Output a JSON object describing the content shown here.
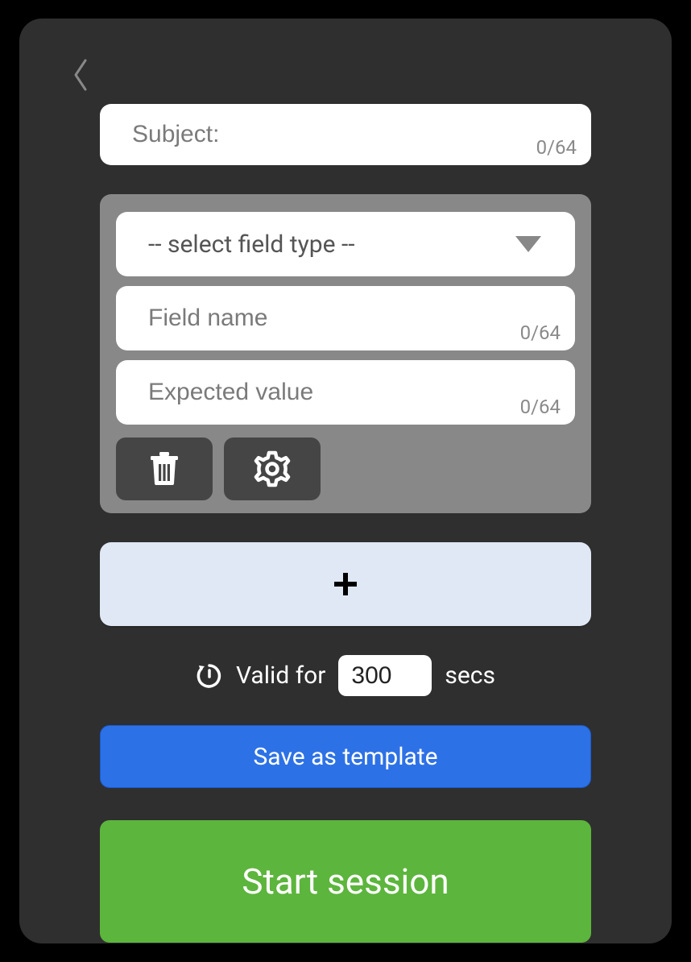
{
  "subject": {
    "placeholder": "Subject:",
    "value": "",
    "counter": "0/64"
  },
  "field": {
    "select_placeholder": "-- select field type --",
    "name_placeholder": "Field name",
    "name_value": "",
    "name_counter": "0/64",
    "expected_placeholder": "Expected value",
    "expected_value": "",
    "expected_counter": "0/64"
  },
  "valid": {
    "label_prefix": "Valid for",
    "value": "300",
    "label_suffix": "secs"
  },
  "buttons": {
    "save_template": "Save as template",
    "start_session": "Start session"
  }
}
